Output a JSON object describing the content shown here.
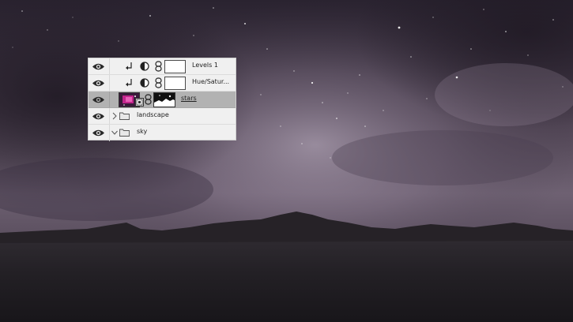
{
  "layers_panel": {
    "layers": [
      {
        "name": "Levels 1",
        "type": "adjustment",
        "visible": true,
        "clipped": true,
        "selected": false,
        "icons": [
          "eye-icon",
          "clip-arrow-icon",
          "adjustment-icon",
          "link-icon",
          "mask-thumbnail"
        ]
      },
      {
        "name": "Hue/Satur...",
        "type": "adjustment",
        "visible": true,
        "clipped": true,
        "selected": false,
        "icons": [
          "eye-icon",
          "clip-arrow-icon",
          "adjustment-icon",
          "link-icon",
          "mask-thumbnail"
        ]
      },
      {
        "name": "stars",
        "type": "smart-object",
        "visible": true,
        "clipped": false,
        "selected": true,
        "icons": [
          "eye-icon",
          "layer-thumbnail",
          "smart-object-icon",
          "link-icon",
          "mask-thumbnail"
        ]
      },
      {
        "name": "landscape",
        "type": "group",
        "visible": true,
        "expanded": false,
        "selected": false,
        "icons": [
          "eye-icon",
          "chevron-right-icon",
          "folder-icon"
        ]
      },
      {
        "name": "sky",
        "type": "group",
        "visible": true,
        "expanded": true,
        "selected": false,
        "icons": [
          "eye-icon",
          "chevron-down-icon",
          "folder-icon"
        ]
      }
    ],
    "selected_row_color": "#b2b2b2"
  },
  "canvas": {
    "sky_colors": [
      "#2c2530",
      "#4d4250",
      "#7a6c7c",
      "#8e8190"
    ],
    "ground_color": "#1c1a1d"
  }
}
